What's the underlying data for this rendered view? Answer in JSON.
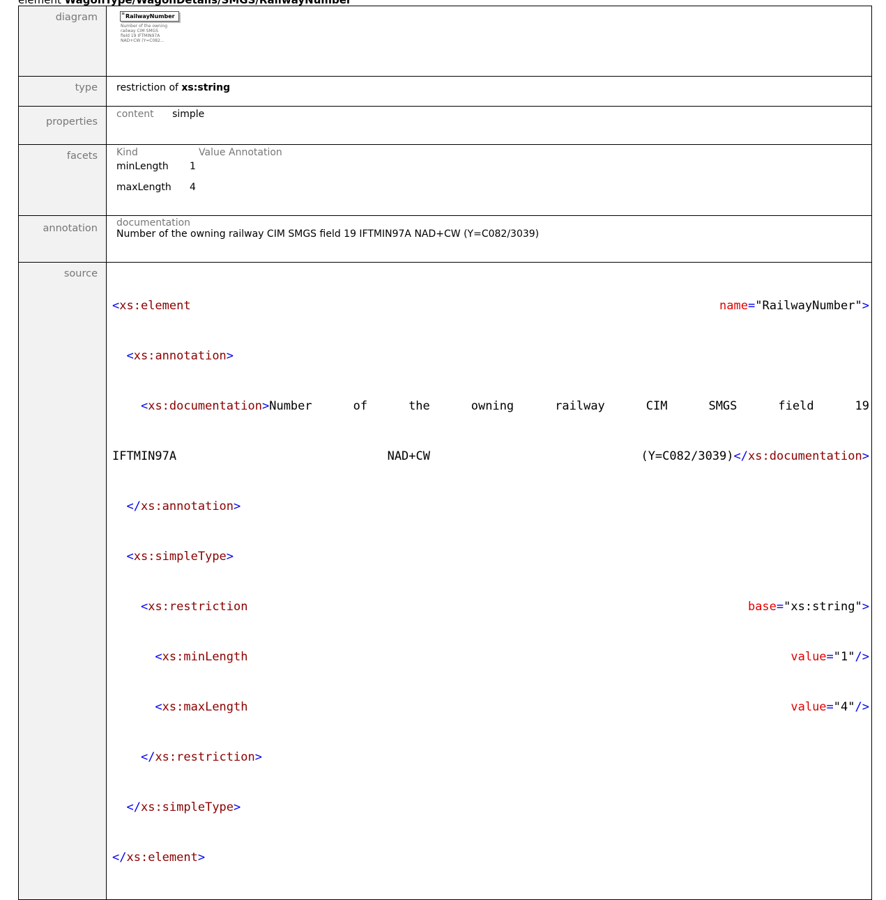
{
  "heading": {
    "prefix": "element",
    "path": "WagonType/WagonDetails/SMGS/RailwayNumber"
  },
  "rows": {
    "diagram": {
      "label": "diagram",
      "element_name": "RailwayNumber",
      "doc_lines": [
        "Number of the owning",
        "railway CIM SMGS",
        "field 19 IFTMIN97A",
        "NAD+CW (Y=C082..."
      ]
    },
    "type": {
      "label": "type",
      "prefix": "restriction of",
      "base": "xs:string"
    },
    "properties": {
      "label": "properties",
      "key": "content",
      "value": "simple"
    },
    "facets": {
      "label": "facets",
      "headers": [
        "Kind",
        "Value",
        "Annotation"
      ],
      "items": [
        {
          "kind": "minLength",
          "value": "1"
        },
        {
          "kind": "maxLength",
          "value": "4"
        }
      ]
    },
    "annotation": {
      "label": "annotation",
      "sub_label": "documentation",
      "text": "Number of the owning railway CIM SMGS field 19 IFTMIN97A NAD+CW (Y=C082/3039)"
    },
    "source": {
      "label": "source",
      "element_tag": "xs:element",
      "name_attr": "name",
      "name_value": "\"RailwayNumber\"",
      "annotation_tag": "xs:annotation",
      "documentation_tag": "xs:documentation",
      "doc_words_line1": [
        "Number",
        "of",
        "the",
        "owning",
        "railway",
        "CIM",
        "SMGS",
        "field",
        "19"
      ],
      "doc_words_line2": [
        "IFTMIN97A",
        "NAD+CW",
        "(Y=C082/3039)"
      ],
      "simpletype_tag": "xs:simpleType",
      "restriction_tag": "xs:restriction",
      "base_attr": "base",
      "base_value": "\"xs:string\"",
      "minlength_tag": "xs:minLength",
      "maxlength_tag": "xs:maxLength",
      "value_attr": "value",
      "min_value": "\"1\"",
      "max_value": "\"4\""
    }
  },
  "colors": {
    "tag": "#8b0000",
    "punctuation": "#0000ee",
    "attribute": "#e00000",
    "label_bg": "#f2f2f2"
  }
}
